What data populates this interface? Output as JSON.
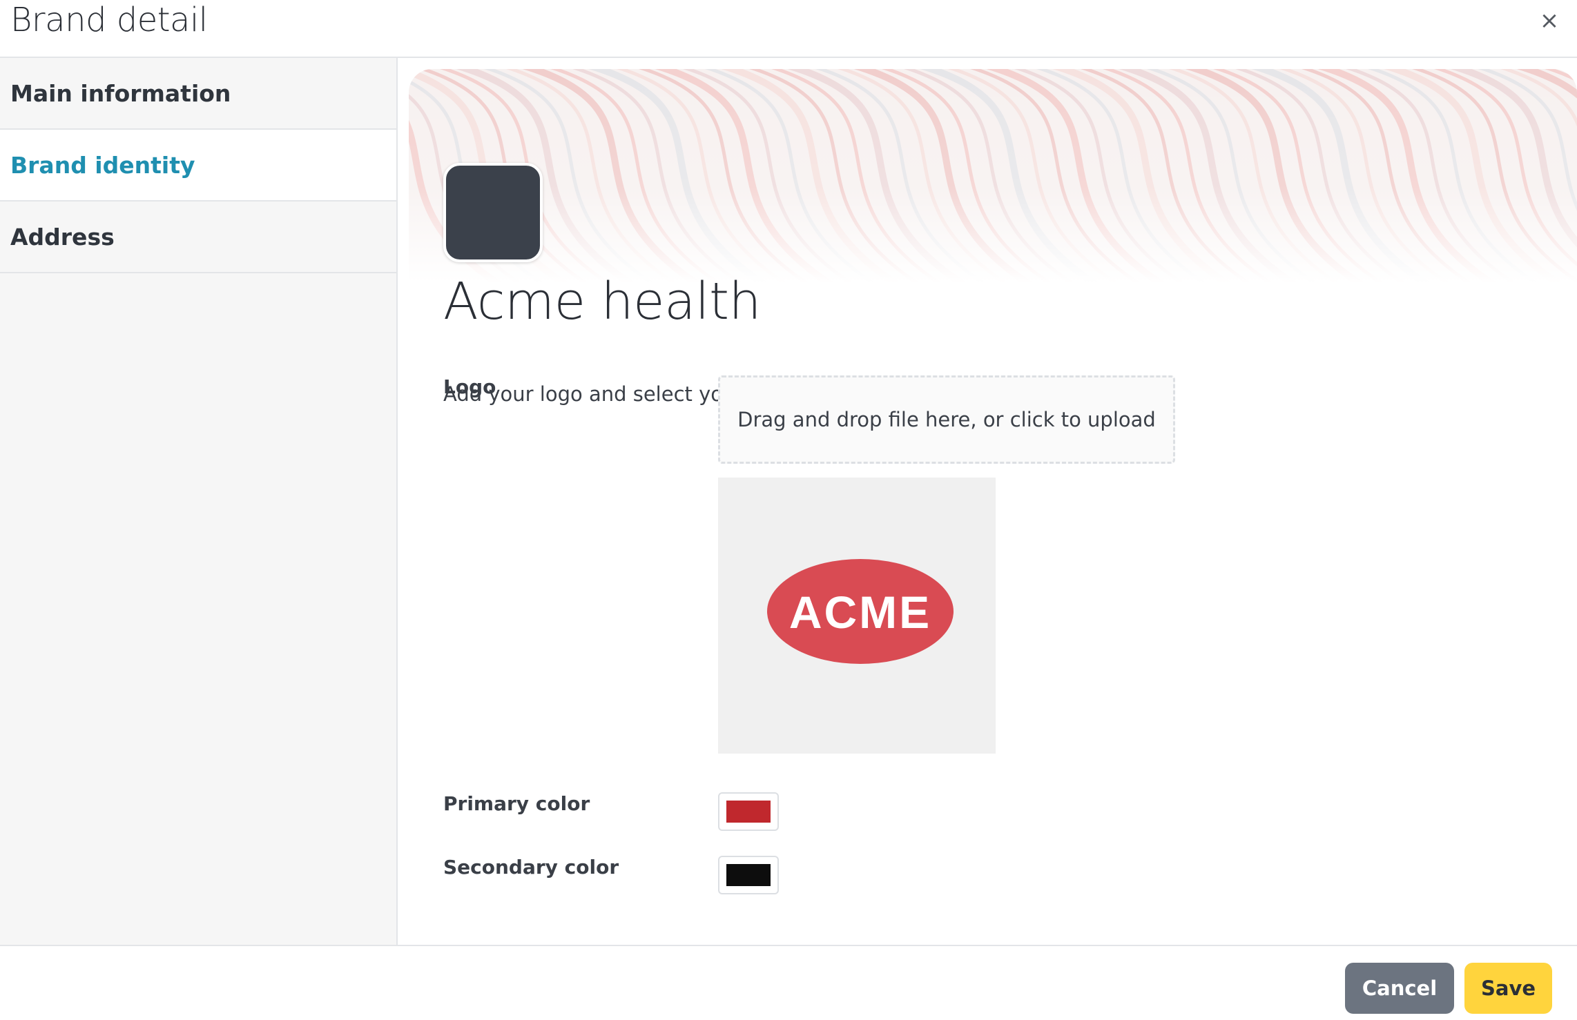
{
  "dialog": {
    "title": "Brand detail",
    "close_label": "×"
  },
  "sidebar": {
    "items": [
      {
        "label": "Main information",
        "active": false
      },
      {
        "label": "Brand identity",
        "active": true
      },
      {
        "label": "Address",
        "active": false
      }
    ]
  },
  "brand": {
    "name": "Acme health"
  },
  "identity": {
    "description": "Add your logo and select your brand's primary and secondary colors.",
    "logo_label": "Logo",
    "dropzone_text": "Drag and drop file here, or click to upload",
    "logo_text": "ACME",
    "primary_color_label": "Primary color",
    "primary_color": "#c0282d",
    "secondary_color_label": "Secondary color",
    "secondary_color": "#0d0d0d"
  },
  "footer": {
    "cancel_label": "Cancel",
    "save_label": "Save"
  },
  "colors": {
    "active_nav": "#1f8fb0",
    "cancel_bg": "#6c7480",
    "save_bg": "#ffd43d",
    "avatar_bg": "#3b414b",
    "logo_red": "#d94b53"
  }
}
